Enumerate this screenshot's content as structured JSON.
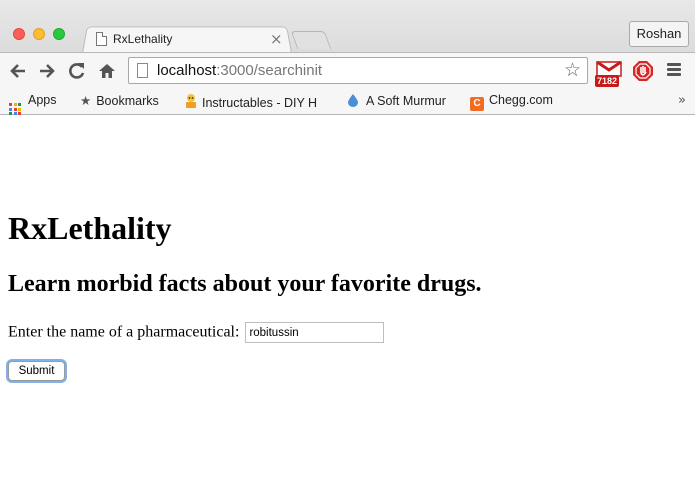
{
  "window": {
    "tab_title": "RxLethality",
    "tab_close": "×",
    "profile_name": "Roshan"
  },
  "toolbar": {
    "url_host": "localhost",
    "url_rest": ":3000/searchinit",
    "gmail_count": "7182",
    "icons": [
      "back-arrow-icon",
      "forward-arrow-icon",
      "reload-icon",
      "home-icon",
      "star-icon",
      "gmail-icon",
      "adblock-icon",
      "menu-icon"
    ]
  },
  "bookmarks": {
    "items": [
      {
        "label": "Apps",
        "icon": "apps-grid-icon"
      },
      {
        "label": "Bookmarks",
        "icon": "star-icon"
      },
      {
        "label": "Instructables - DIY H",
        "icon": "instructables-icon"
      },
      {
        "label": "A Soft Murmur",
        "icon": "water-drop-icon"
      },
      {
        "label": "Chegg.com",
        "icon": "chegg-icon",
        "icon_letter": "C"
      }
    ],
    "more": "»"
  },
  "page": {
    "title": "RxLethality",
    "subtitle": "Learn morbid facts about your favorite drugs.",
    "form_label": "Enter the name of a pharmaceutical:",
    "input_value": "robitussin",
    "submit_label": "Submit"
  },
  "colors": {
    "traffic_red": "#fc5f57",
    "traffic_yellow": "#fdbc2e",
    "traffic_green": "#28c840",
    "focus_ring": "#7fb2e8",
    "gmail_red": "#c71a1a",
    "chegg_orange": "#f26b21"
  }
}
